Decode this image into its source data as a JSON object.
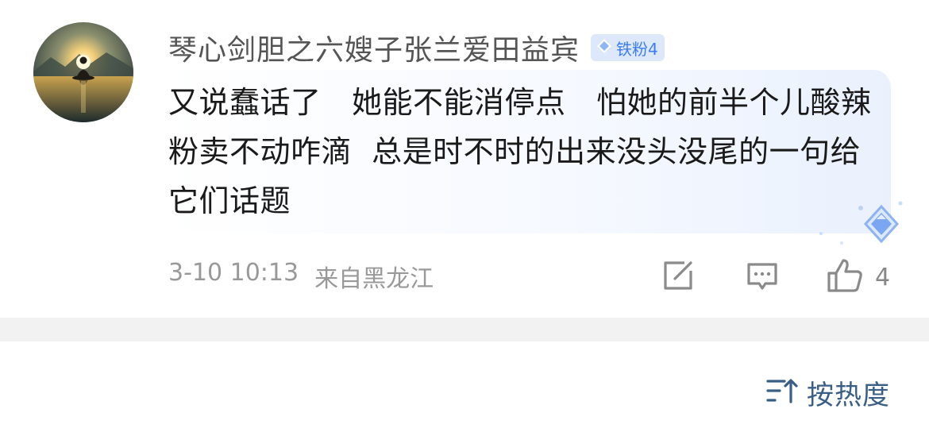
{
  "comment": {
    "username": "琴心剑胆之六嫂子张兰爱田益宾",
    "fan_badge": {
      "icon": "diamond-icon",
      "label": "铁粉4",
      "color": "#3d7df0"
    },
    "text": "又说蠢话了　她能不能消停点　怕她的前半个儿酸辣粉卖不动咋滴  总是时不时的出来没头没尾的一句给它们话题",
    "date": "3-10 10:13",
    "location": "来自黑龙江",
    "like_count": "4",
    "actions": [
      "share-icon",
      "reply-icon",
      "thumbs-up-icon"
    ]
  },
  "sort": {
    "icon": "sort-icon",
    "label": "按热度"
  }
}
